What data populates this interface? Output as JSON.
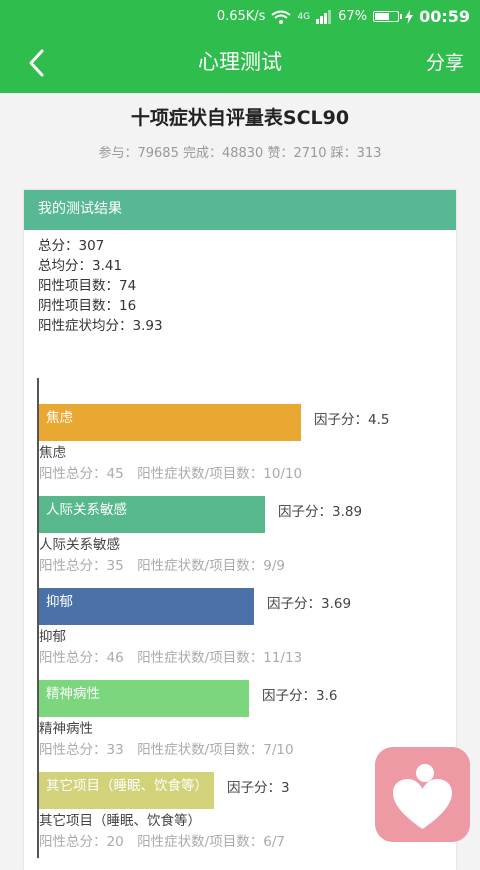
{
  "status_bar": {
    "speed": "0.65K/s",
    "network": "4G",
    "battery_percent": "67%",
    "battery_level": 0.67,
    "time": "00:59"
  },
  "app_bar": {
    "title": "心理测试",
    "share_label": "分享",
    "back_icon": "chevron-left-icon"
  },
  "test": {
    "title": "十项症状自评量表SCL90",
    "stats": "参与：79685 完成：48830 赞：2710 踩：313"
  },
  "result": {
    "header": "我的测试结果",
    "summary": [
      "总分：307",
      "总均分：3.41",
      "阳性项目数：74",
      "阴性项目数：16",
      "阳性症状均分：3.93"
    ]
  },
  "chart_data": {
    "type": "bar",
    "orientation": "horizontal",
    "categories": [
      "焦虑",
      "人际关系敏感",
      "抑郁",
      "精神病性",
      "其它项目（睡眠、饮食等）"
    ],
    "values": [
      4.5,
      3.89,
      3.69,
      3.6,
      3
    ],
    "colors": [
      "#e9a832",
      "#57b88b",
      "#4a72a8",
      "#7bd67d",
      "#d2d27a"
    ],
    "factor_labels": [
      "因子分：4.5",
      "因子分：3.89",
      "因子分：3.69",
      "因子分：3.6",
      "因子分：3"
    ],
    "bar_labels": [
      "焦虑",
      "人际关系敏感",
      "抑郁",
      "精神病性",
      "其它项目（睡眠、饮食等）"
    ],
    "details": [
      "阳性总分：45　阳性症状数/项目数：10/10",
      "阳性总分：35　阳性症状数/项目数：9/9",
      "阳性总分：46　阳性症状数/项目数：11/13",
      "阳性总分：33　阳性症状数/项目数：7/10",
      "阳性总分：20　阳性症状数/项目数：6/7"
    ]
  },
  "floating_button": {
    "icon": "heart-person-icon",
    "color": "#ee9aa5"
  }
}
